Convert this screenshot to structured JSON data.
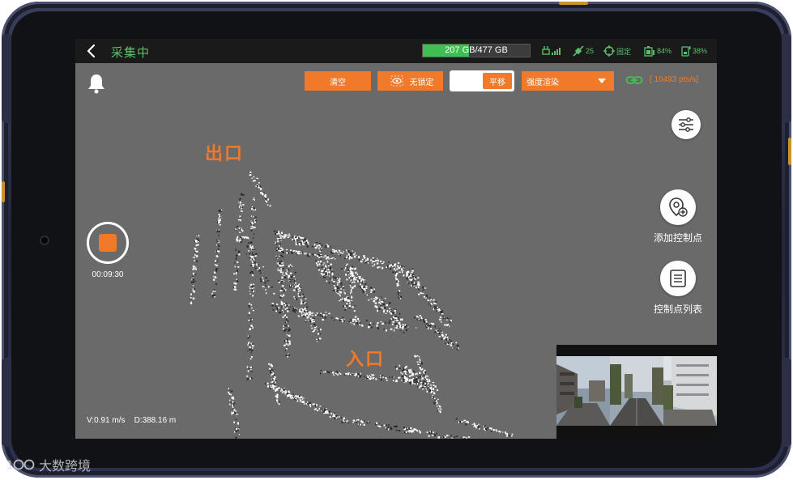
{
  "colors": {
    "accent": "#f07a2a",
    "status_green": "#58c06a",
    "screen_bg": "#6a6a6a"
  },
  "statusbar": {
    "title": "采集中",
    "storage": {
      "text": "207 GB/477 GB",
      "fraction": 0.434
    },
    "satellites": "25",
    "fix_status": "固定",
    "device_battery": "84%",
    "phone_battery": "38%"
  },
  "toolbar": {
    "clear_label": "清空",
    "lock_label": "无锁定",
    "pan_label": "平移",
    "render_mode": "强度渲染",
    "pts_rate": "[ 10493 pts/s]"
  },
  "map": {
    "exit_label": "出口",
    "entry_label": "入口"
  },
  "recording": {
    "elapsed": "00:09:30"
  },
  "right_panel": {
    "add_control_point": "添加控制点",
    "control_point_list": "控制点列表"
  },
  "readout": {
    "velocity": "V:0.91 m/s",
    "distance": "D:388.16 m"
  },
  "watermark": {
    "text": "大数跨境"
  },
  "icons": [
    "back-icon",
    "bell-icon",
    "link-icon",
    "signal-icon",
    "satellite-icon",
    "crosshair-icon",
    "device-battery-icon",
    "phone-battery-icon",
    "settings-sliders-icon",
    "add-location-icon",
    "list-icon",
    "stop-icon",
    "eye-icon"
  ]
}
